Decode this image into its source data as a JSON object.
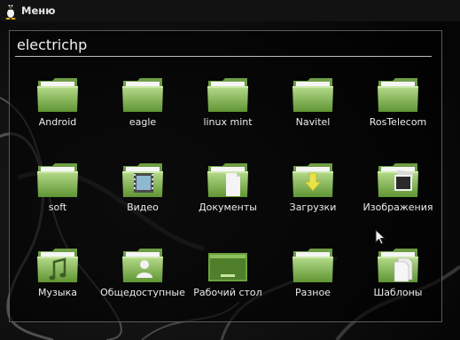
{
  "taskbar": {
    "menu_label": "Меню"
  },
  "window": {
    "title": "electrichp"
  },
  "folders": [
    {
      "label": "Android",
      "icon": "folder-icon"
    },
    {
      "label": "eagle",
      "icon": "folder-icon"
    },
    {
      "label": "linux mint",
      "icon": "folder-icon"
    },
    {
      "label": "Navitel",
      "icon": "folder-icon"
    },
    {
      "label": "RosTelecom",
      "icon": "folder-icon"
    },
    {
      "label": "soft",
      "icon": "folder-icon"
    },
    {
      "label": "Видео",
      "icon": "folder-video-icon"
    },
    {
      "label": "Документы",
      "icon": "folder-documents-icon"
    },
    {
      "label": "Загрузки",
      "icon": "folder-download-icon"
    },
    {
      "label": "Изображения",
      "icon": "folder-pictures-icon"
    },
    {
      "label": "Музыка",
      "icon": "folder-music-icon"
    },
    {
      "label": "Общедоступные",
      "icon": "folder-public-icon"
    },
    {
      "label": "Рабочий стол",
      "icon": "folder-desktop-icon"
    },
    {
      "label": "Разное",
      "icon": "folder-icon"
    },
    {
      "label": "Шаблоны",
      "icon": "folder-templates-icon"
    }
  ],
  "colors": {
    "folder_green_light": "#b6dc8c",
    "folder_green_dark": "#5f9433",
    "background": "#0a0a0a"
  }
}
